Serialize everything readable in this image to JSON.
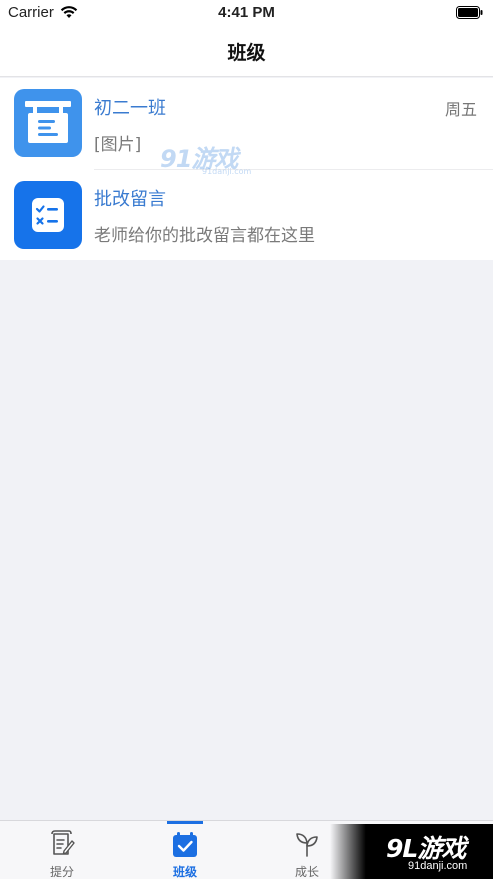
{
  "status_bar": {
    "carrier": "Carrier",
    "time": "4:41 PM"
  },
  "nav": {
    "title": "班级"
  },
  "list": {
    "items": [
      {
        "title": "初二一班",
        "subtitle": "[图片]",
        "time": "周五",
        "icon": "class-board-icon",
        "color": "#3f93ec"
      },
      {
        "title": "批改留言",
        "subtitle": "老师给你的批改留言都在这里",
        "time": "",
        "icon": "checklist-icon",
        "color": "#1673ea"
      }
    ]
  },
  "tabs": [
    {
      "label": "提分",
      "icon": "scroll-edit-icon",
      "active": false
    },
    {
      "label": "班级",
      "icon": "class-check-icon",
      "active": true
    },
    {
      "label": "成长",
      "icon": "sprout-icon",
      "active": false
    }
  ],
  "watermarks": {
    "top_logo": "91游戏",
    "top_url": "91danji.com",
    "bottom_logo": "9L游戏",
    "bottom_url": "91danji.com"
  },
  "colors": {
    "accent": "#1c6fe2",
    "title_blue": "#3a7bd0",
    "background": "#f1f2f6"
  }
}
